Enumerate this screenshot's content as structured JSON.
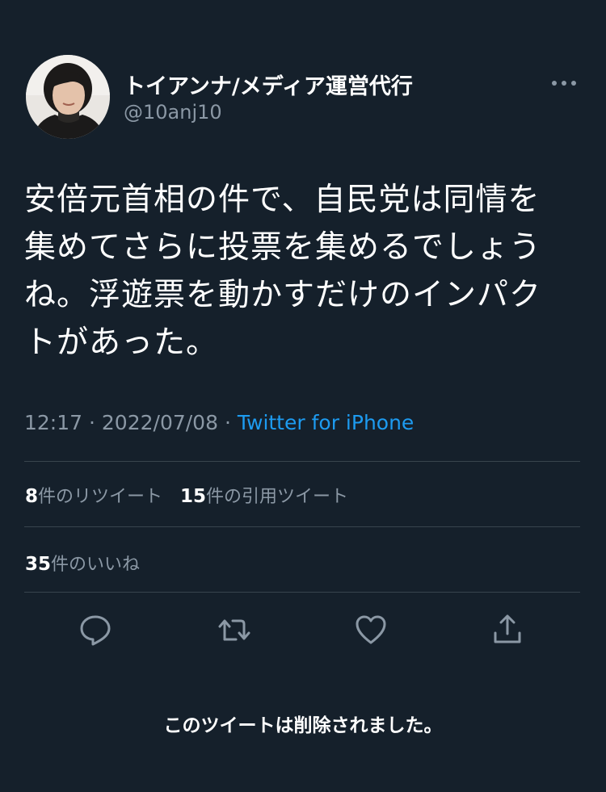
{
  "author": {
    "display_name": "トイアンナ/メディア運営代行",
    "handle": "@10anj10"
  },
  "tweet": {
    "text": "安倍元首相の件で、自民党は同情を\n集めてさらに投票を集めるでしょう\nね。浮遊票を動かすだけのインパク\nトがあった。",
    "time": "12:17",
    "separator": "·",
    "date": "2022/07/08",
    "source": "Twitter for iPhone"
  },
  "stats": {
    "retweets_count": "8",
    "retweets_label": "件のリツイート",
    "quotes_count": "15",
    "quotes_label": "件の引用ツイート",
    "likes_count": "35",
    "likes_label": "件のいいね"
  },
  "notice": {
    "deleted": "このツイートは削除されました。"
  },
  "icons": {
    "more": "more-horizontal-icon",
    "reply": "reply-icon",
    "retweet": "retweet-icon",
    "like": "heart-icon",
    "share": "share-icon"
  },
  "colors": {
    "background": "#15202b",
    "text": "#ffffff",
    "secondary": "#8b98a5",
    "link": "#1d9bf0",
    "divider": "#38444d"
  }
}
